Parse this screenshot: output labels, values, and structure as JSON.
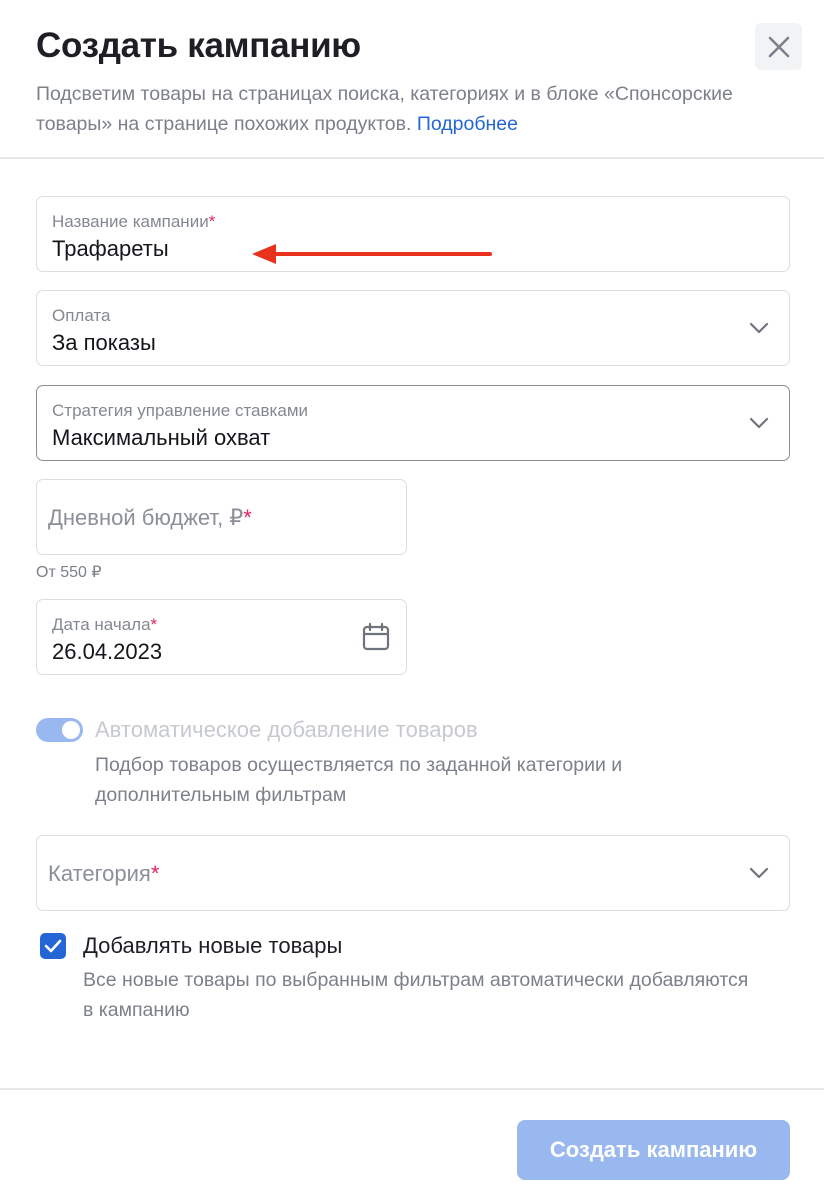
{
  "modal": {
    "title": "Создать кампанию",
    "subtitle": "Подсветим товары на страницах поиска, категориях и в блоке «Спонсорские товары» на странице похожих продуктов.",
    "subtitle_link": "Подробнее",
    "close_icon": "close-icon"
  },
  "fields": {
    "campaign_name": {
      "label": "Название кампании",
      "required_mark": "*",
      "value": "Трафареты"
    },
    "payment": {
      "label": "Оплата",
      "value": "За показы"
    },
    "strategy": {
      "label": "Стратегия управление ставками",
      "value": "Максимальный охват"
    },
    "daily_budget": {
      "placeholder": "Дневной бюджет, ₽",
      "required_mark": "*",
      "hint": "От 550 ₽"
    },
    "start_date": {
      "label": "Дата начала",
      "required_mark": "*",
      "value": "26.04.2023",
      "icon": "calendar-icon"
    },
    "category": {
      "placeholder": "Категория",
      "required_mark": "*"
    }
  },
  "auto_add": {
    "enabled": true,
    "title": "Автоматическое добавление товаров",
    "description": "Подбор товаров осуществляется по заданной категории и дополнительным фильтрам"
  },
  "add_new": {
    "checked": true,
    "title": "Добавлять новые товары",
    "description": "Все новые товары по выбранным фильтрам автоматически добавляются в кампанию"
  },
  "footer": {
    "submit_label": "Создать кампанию"
  },
  "colors": {
    "accent": "#2466d6",
    "disabled_accent": "#9ab8f0",
    "required": "#e0245e",
    "annotation_arrow": "#e8321e"
  }
}
